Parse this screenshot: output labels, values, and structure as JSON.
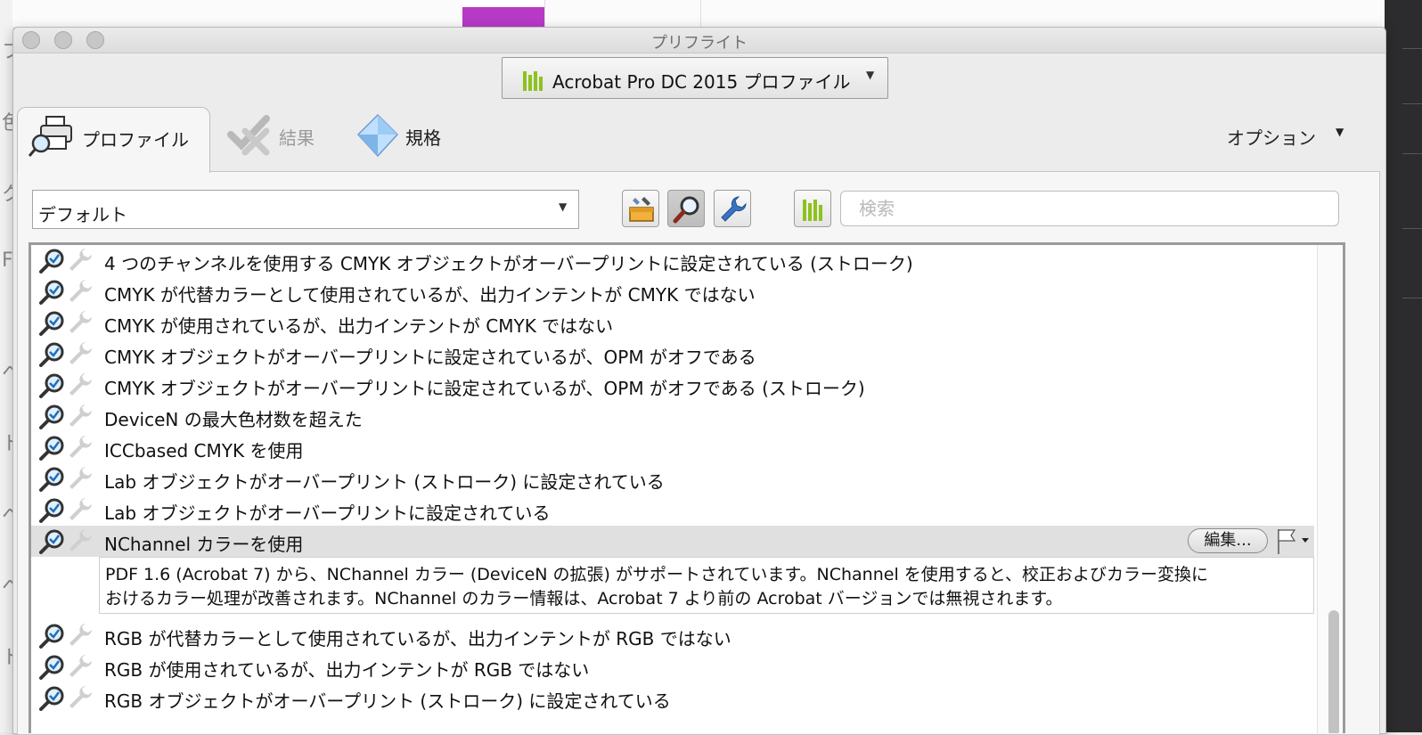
{
  "window": {
    "title": "プリフライト"
  },
  "profile_select": {
    "label": "Acrobat Pro DC 2015 プロファイル",
    "icon": "library-bars-icon"
  },
  "tabs": [
    {
      "label": "プロファイル",
      "icon": "printer-magnifier-icon",
      "active": true
    },
    {
      "label": "結果",
      "icon": "check-cross-icon",
      "active": false
    },
    {
      "label": "規格",
      "icon": "diamond-icon",
      "active": false
    }
  ],
  "options": {
    "label": "オプション"
  },
  "toolbar": {
    "group_select": "デフォルト",
    "search_placeholder": "検索",
    "tools": [
      "fixup-toolbox-icon",
      "magnifier-icon",
      "wrench-icon",
      "library-bars-icon"
    ]
  },
  "checks": [
    "4 つのチャンネルを使用する CMYK オブジェクトがオーバープリントに設定されている (ストローク)",
    "CMYK が代替カラーとして使用されているが、出力インテントが CMYK ではない",
    "CMYK が使用されているが、出力インテントが CMYK ではない",
    "CMYK オブジェクトがオーバープリントに設定されているが、OPM がオフである",
    "CMYK オブジェクトがオーバープリントに設定されているが、OPM がオフである (ストローク)",
    "DeviceN の最大色材数を超えた",
    "ICCbased CMYK を使用",
    "Lab オブジェクトがオーバープリント (ストローク) に設定されている",
    "Lab オブジェクトがオーバープリントに設定されている",
    "NChannel カラーを使用",
    "RGB が代替カラーとして使用されているが、出力インテントが RGB ではない",
    "RGB が使用されているが、出力インテントが RGB ではない",
    "RGB オブジェクトがオーバープリント (ストローク) に設定されている"
  ],
  "selected": {
    "edit_label": "編集...",
    "description_line1": "PDF 1.6 (Acrobat 7) から、NChannel カラー (DeviceN の拡張) がサポートされています。NChannel を使用すると、校正およびカラー変換に",
    "description_line2": "おけるカラー処理が改善されます。NChannel のカラー情報は、Acrobat 7 より前の Acrobat バージョンでは無視されます。"
  },
  "colors": {
    "library_green": "#8dc21f",
    "selection": "#e0e0e0"
  }
}
